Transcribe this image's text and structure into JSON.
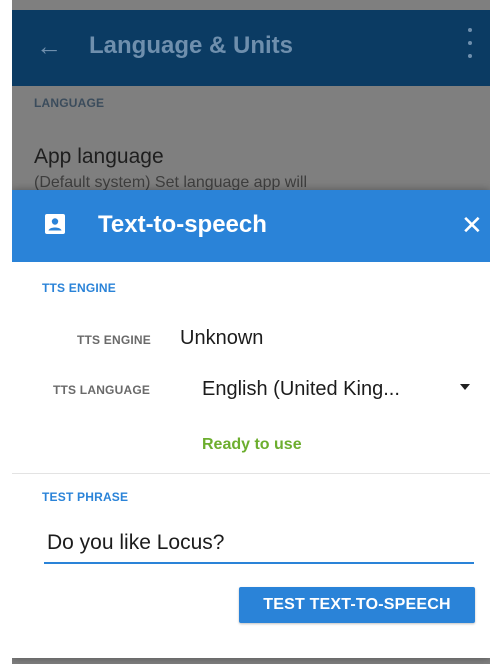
{
  "background_screen": {
    "title": "Language & Units",
    "back_icon": "arrow-left-icon",
    "menu_icon": "overflow-menu-icon",
    "section_header": "LANGUAGE",
    "item_title": "App language",
    "item_subtitle": "(Default system) Set language app will"
  },
  "dialog": {
    "title": "Text-to-speech",
    "header_icon": "person-card-icon",
    "close_icon": "close-icon",
    "engine_section": "TTS ENGINE",
    "engine_label": "TTS ENGINE",
    "engine_value": "Unknown",
    "language_label": "TTS LANGUAGE",
    "language_value": "English (United King...",
    "status": "Ready to use",
    "phrase_section": "TEST PHRASE",
    "phrase_value": "Do you like Locus?",
    "test_button": "TEST TEXT-TO-SPEECH"
  },
  "colors": {
    "appbar": "#0b3b63",
    "accent": "#2a83d8",
    "status_ready": "#6cae2e",
    "dim_overlay": "#7f7f7f"
  }
}
